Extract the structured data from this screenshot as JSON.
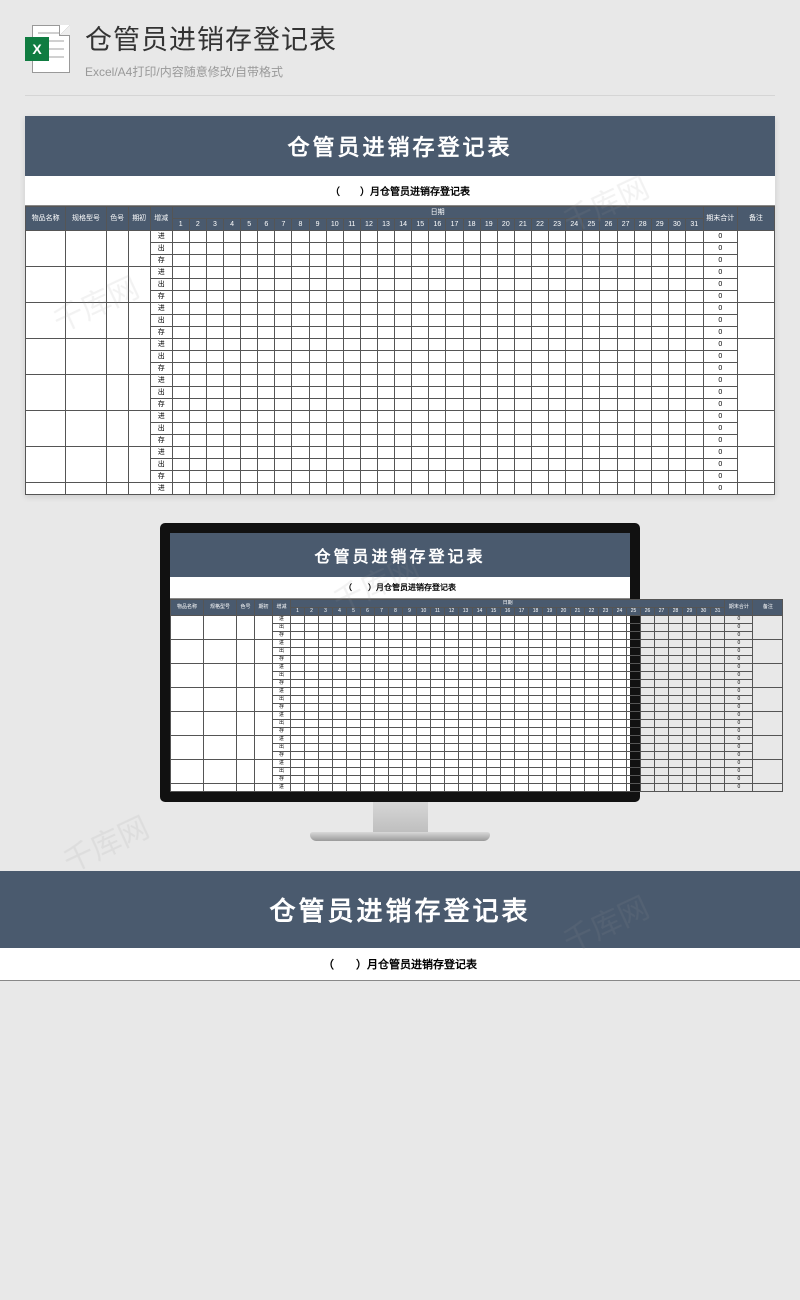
{
  "header": {
    "icon_letter": "X",
    "title": "仓管员进销存登记表",
    "subtitle": "Excel/A4打印/内容随意修改/自带格式"
  },
  "sheet": {
    "banner": "仓管员进销存登记表",
    "subtitle": "（　　）月仓管员进销存登记表",
    "cols": {
      "name": "物品名称",
      "spec": "规格型号",
      "color": "色号",
      "init": "期初",
      "change": "增减",
      "date_span": "日期",
      "days": [
        "1",
        "2",
        "3",
        "4",
        "5",
        "6",
        "7",
        "8",
        "9",
        "10",
        "11",
        "12",
        "13",
        "14",
        "15",
        "16",
        "17",
        "18",
        "19",
        "20",
        "21",
        "22",
        "23",
        "24",
        "25",
        "26",
        "27",
        "28",
        "29",
        "30",
        "31"
      ],
      "total": "期末合计",
      "note": "备注"
    },
    "change_labels": {
      "in": "进",
      "out": "出",
      "stock": "存"
    },
    "total_default": "0",
    "groups": 7
  },
  "watermark": "千库网"
}
